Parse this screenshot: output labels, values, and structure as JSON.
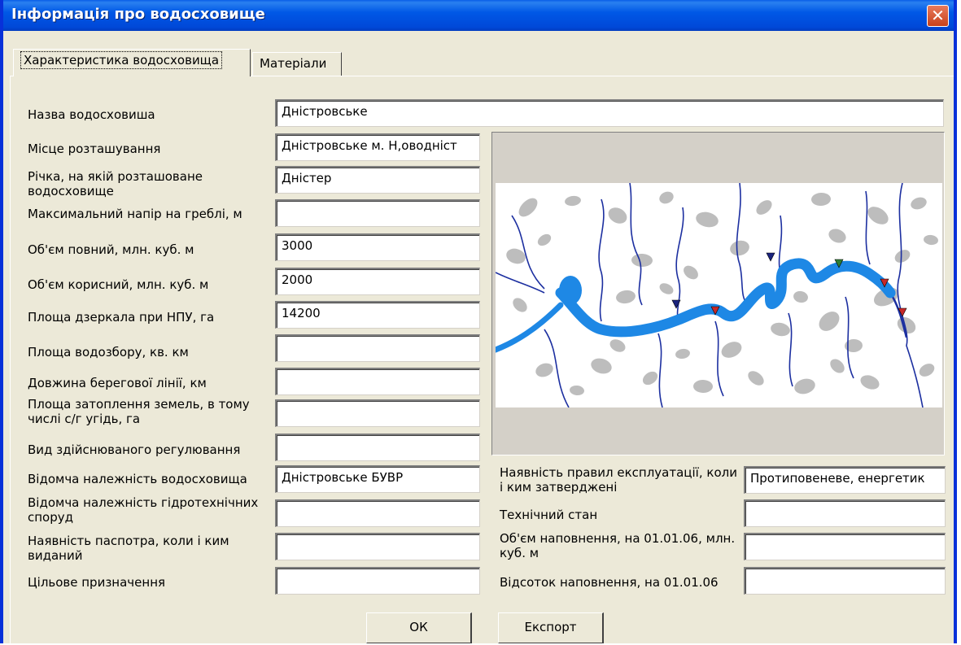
{
  "window": {
    "title": "Інформація про водосховище",
    "close_label": "✕"
  },
  "tabs": [
    {
      "label": "Характеристика водосховища",
      "active": true
    },
    {
      "label": "Матеріали",
      "active": false
    }
  ],
  "left_fields": [
    {
      "label": "Назва водосховиша",
      "value": "Дністровське"
    },
    {
      "label": "Місце розташування",
      "value": "Дністровське м. Н,оводніст"
    },
    {
      "label": "Річка, на якій розташоване водосховище",
      "value": "Дністер"
    },
    {
      "label": "Максимальний напір на греблі, м",
      "value": ""
    },
    {
      "label": "Об'єм повний, млн. куб. м",
      "value": "3000"
    },
    {
      "label": "Об'єм корисний, млн. куб. м",
      "value": "2000"
    },
    {
      "label": "Площа дзеркала при НПУ, га",
      "value": "14200"
    },
    {
      "label": "Площа водозбору, кв. км",
      "value": ""
    },
    {
      "label": "Довжина берегової лінії, км",
      "value": ""
    },
    {
      "label": "Площа затоплення земель, в тому числі с/г угідь, га",
      "value": ""
    },
    {
      "label": "Вид здійснюваного регулювання",
      "value": ""
    },
    {
      "label": "Відомча належність водосховища",
      "value": "Дністровське БУВР"
    },
    {
      "label": "Відомча належність гідротехнічних споруд",
      "value": ""
    },
    {
      "label": "Наявність паспотра, коли і ким виданий",
      "value": ""
    },
    {
      "label": "Цільове призначення",
      "value": ""
    }
  ],
  "right_fields": [
    {
      "label": "Наявність правил експлуатації, коли і ким затверджені",
      "value": "Протиповеневе, енергетик"
    },
    {
      "label": "Технічний стан",
      "value": ""
    },
    {
      "label": "Об'єм наповнення, на 01.01.06, млн. куб. м",
      "value": ""
    },
    {
      "label": "Відсоток наповнення, на 01.01.06",
      "value": ""
    }
  ],
  "buttons": {
    "ok": "ОК",
    "export": "Експорт"
  },
  "colors": {
    "titlebar": "#0058e6",
    "water": "#1e88e5",
    "river": "#1c2fa0",
    "settlement": "#bdbdbd",
    "marker_red": "#c62828",
    "marker_blue": "#1a237e",
    "marker_green": "#2e7d32"
  }
}
